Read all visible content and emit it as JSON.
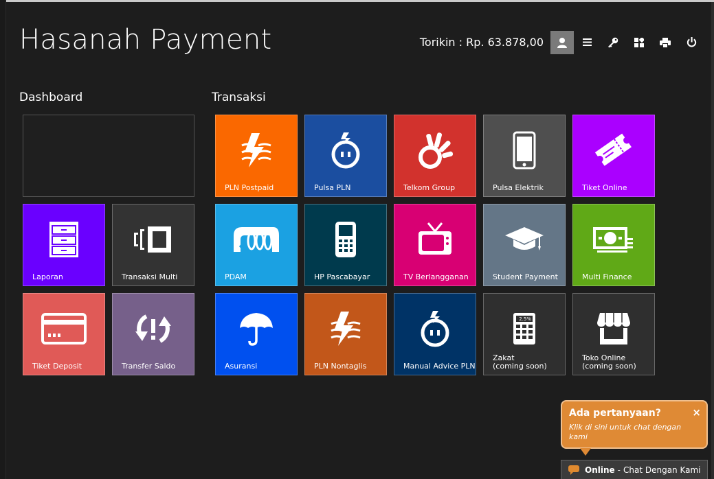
{
  "app": {
    "title": "Hasanah Payment"
  },
  "topbar": {
    "balance": "Torikin : Rp. 63.878,00",
    "buttons": [
      "user-icon",
      "menu-icon",
      "key-icon",
      "apps-icon",
      "printer-icon",
      "power-icon"
    ]
  },
  "sections": {
    "dashboard": "Dashboard",
    "transaksi": "Transaksi"
  },
  "dashboard": {
    "tiles": [
      {
        "label": "Laporan",
        "color": "#6a00ff",
        "icon": "cabinet-icon"
      },
      {
        "label": "Transaksi Multi",
        "color": "#333333",
        "icon": "multi-transaction-icon"
      },
      {
        "label": "Tiket Deposit",
        "color": "#e05a57",
        "icon": "card-icon"
      },
      {
        "label": "Transfer Saldo",
        "color": "#76608a",
        "icon": "transfer-icon"
      }
    ]
  },
  "transaksi": {
    "tiles": [
      {
        "label": "PLN Postpaid",
        "color": "#fa6800",
        "icon": "electricity-icon"
      },
      {
        "label": "Pulsa PLN",
        "color": "#1b4ea0",
        "icon": "bulb-icon"
      },
      {
        "label": "Telkom Group",
        "color": "#d2322d",
        "icon": "telkom-icon"
      },
      {
        "label": "Pulsa Elektrik",
        "color": "#4f4f4f",
        "icon": "phone-icon"
      },
      {
        "label": "Tiket Online",
        "color": "#aa00ff",
        "icon": "ticket-icon"
      },
      {
        "label": "PDAM",
        "color": "#1ba1e2",
        "icon": "water-pipe-icon"
      },
      {
        "label": "HP Pascabayar",
        "color": "#003a4d",
        "icon": "mobile-phone-icon"
      },
      {
        "label": "TV Berlangganan",
        "color": "#d80073",
        "icon": "tv-icon"
      },
      {
        "label": "Student Payment",
        "color": "#647687",
        "icon": "graduation-cap-icon"
      },
      {
        "label": "Multi Finance",
        "color": "#60a917",
        "icon": "money-icon"
      },
      {
        "label": "Asuransi",
        "color": "#0050ef",
        "icon": "umbrella-icon"
      },
      {
        "label": "PLN Nontaglis",
        "color": "#c2571a",
        "icon": "electricity-icon"
      },
      {
        "label": "Manual Advice PLN",
        "color": "#003366",
        "icon": "bulb-icon"
      },
      {
        "label": "Zakat\n(coming soon)",
        "color": "#2f2f2f",
        "icon": "calculator-icon"
      },
      {
        "label": "Toko Online\n(coming soon)",
        "color": "#2f2f2f",
        "icon": "shop-icon"
      }
    ]
  },
  "calculator_display": "2.5%",
  "chat": {
    "question": "Ada pertanyaan?",
    "close": "×",
    "subtitle": "Klik di sini untuk chat dengan kami",
    "status": "Online",
    "separator": "-",
    "action": "Chat Dengan Kami"
  }
}
